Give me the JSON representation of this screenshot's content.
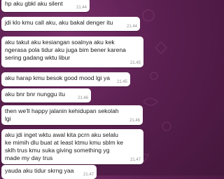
{
  "theme": {
    "bubble_color": "#ffffff",
    "text_color": "#1a1a1a",
    "time_color": "#8f8f8f",
    "wallpaper_color": "#5a1f4f"
  },
  "messages": [
    {
      "text": "hp aku gbkl aku silent",
      "time": "21.44"
    },
    {
      "text": "jdi klo kmu call aku, aku bakal denger itu",
      "time": "21.44"
    },
    {
      "text": "aku takut aku kesiangan soalnya aku kek\nngerasa pola tidur aku juga bim bener karena\nsering gadang wktu libur",
      "time": "21.45"
    },
    {
      "text": "aku harap kmu besok good mood lgi ya",
      "time": "21.45"
    },
    {
      "text": "aku bnr bnr nunggu itu",
      "time": "21.46"
    },
    {
      "text": "then we'll happy jalanin kehidupan sekolah\nlgi",
      "time": "21.46"
    },
    {
      "text": "aku jdi inget wktu awal kita pcrn aku selalu\nke mimih dlu buat at least ktmu kmu sblm ke\nsklh trus kmu suka giving something yg\nmade my day trus",
      "time": "21.47"
    },
    {
      "text": "yauda aku tidur skrng yaa",
      "time": "21.47"
    }
  ]
}
